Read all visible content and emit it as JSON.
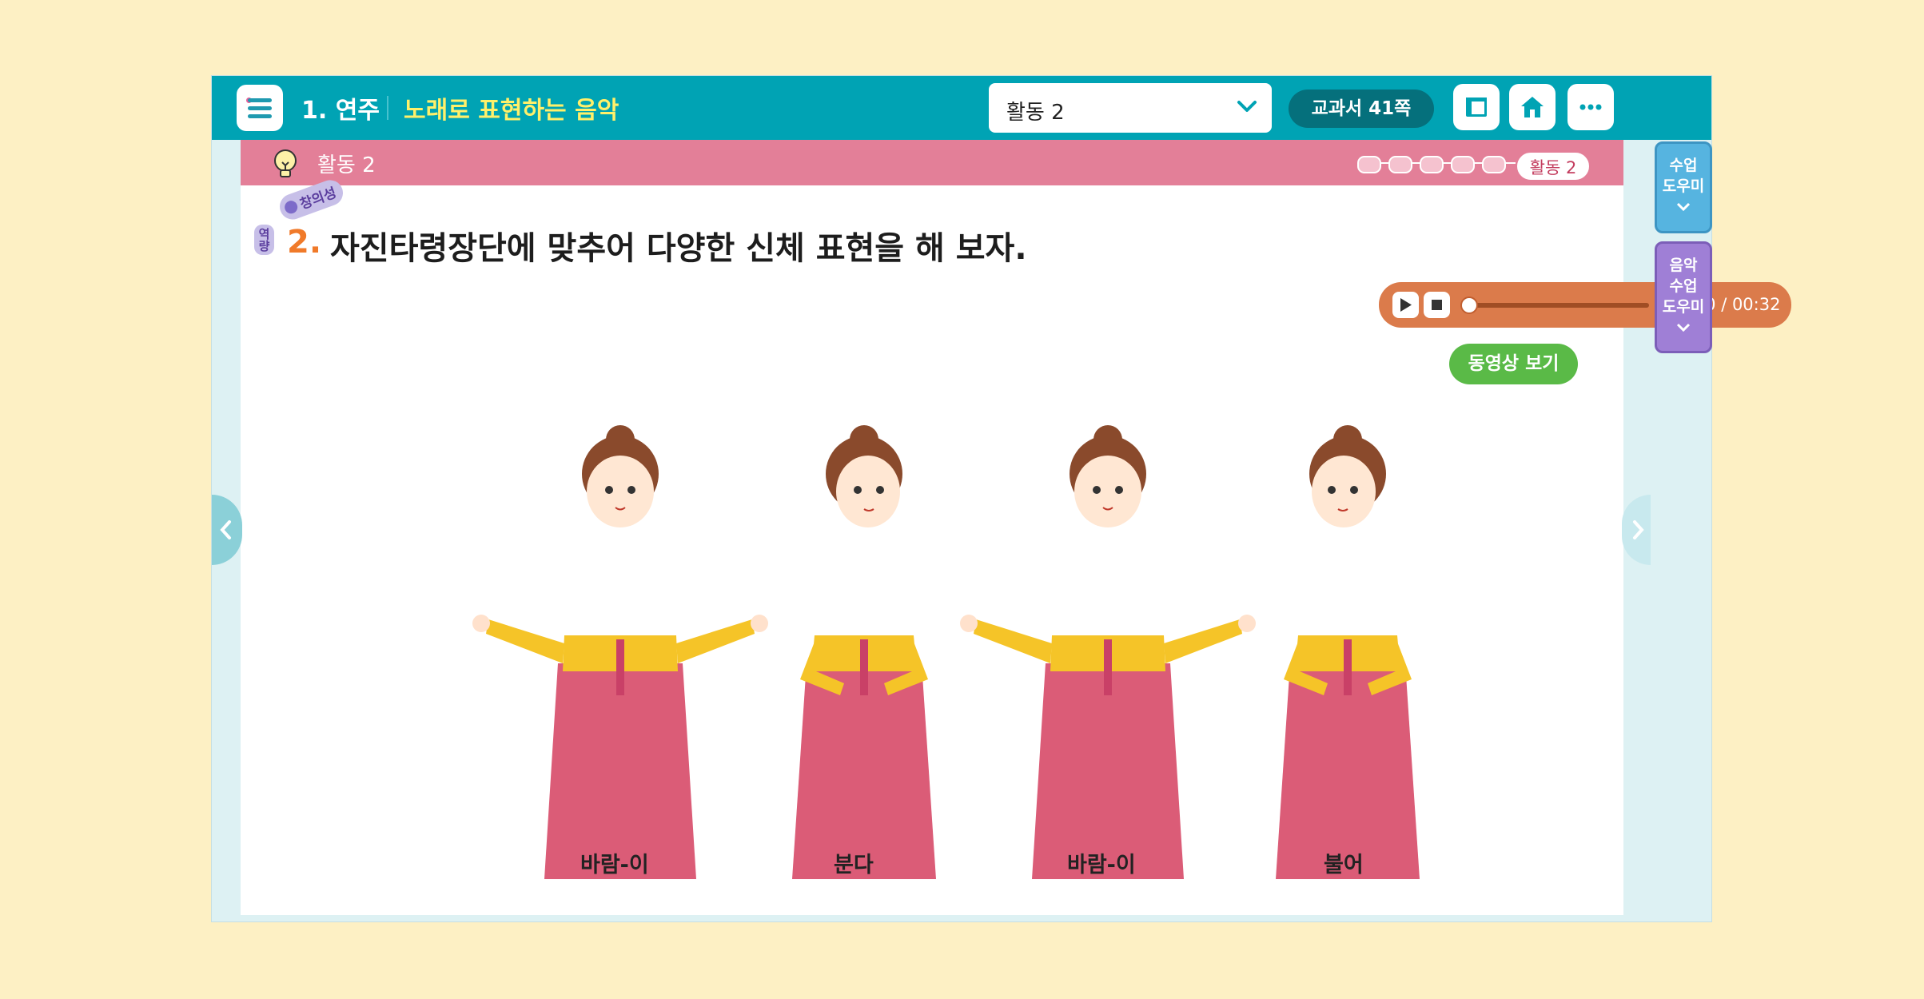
{
  "header": {
    "unit": "1. 연주",
    "lesson": "노래로 표현하는 음악",
    "activity_select": "활동 2",
    "page_ref": "교과서 41쪽"
  },
  "card": {
    "activity_label": "활동 2",
    "progress_current": "활동 2",
    "badge": "창의성",
    "badge_side": "역량",
    "question_number": "2.",
    "question_text": "자진타령장단에 맞추어 다양한 신체 표현을 해 보자."
  },
  "player": {
    "time": "00:00 / 00:32",
    "progress": 0
  },
  "video_button": "동영상 보기",
  "figures": [
    {
      "label": "바람-이"
    },
    {
      "label": "분다"
    },
    {
      "label": "바람-이"
    },
    {
      "label": "불어"
    }
  ],
  "side_tabs": {
    "class_helper": "수업\n도우미",
    "music_helper": "음악\n수업\n도우미"
  },
  "colors": {
    "topbar": "#00a3b4",
    "card_header": "#e37f98",
    "player": "#db7b4b",
    "video_button": "#5aba47"
  }
}
